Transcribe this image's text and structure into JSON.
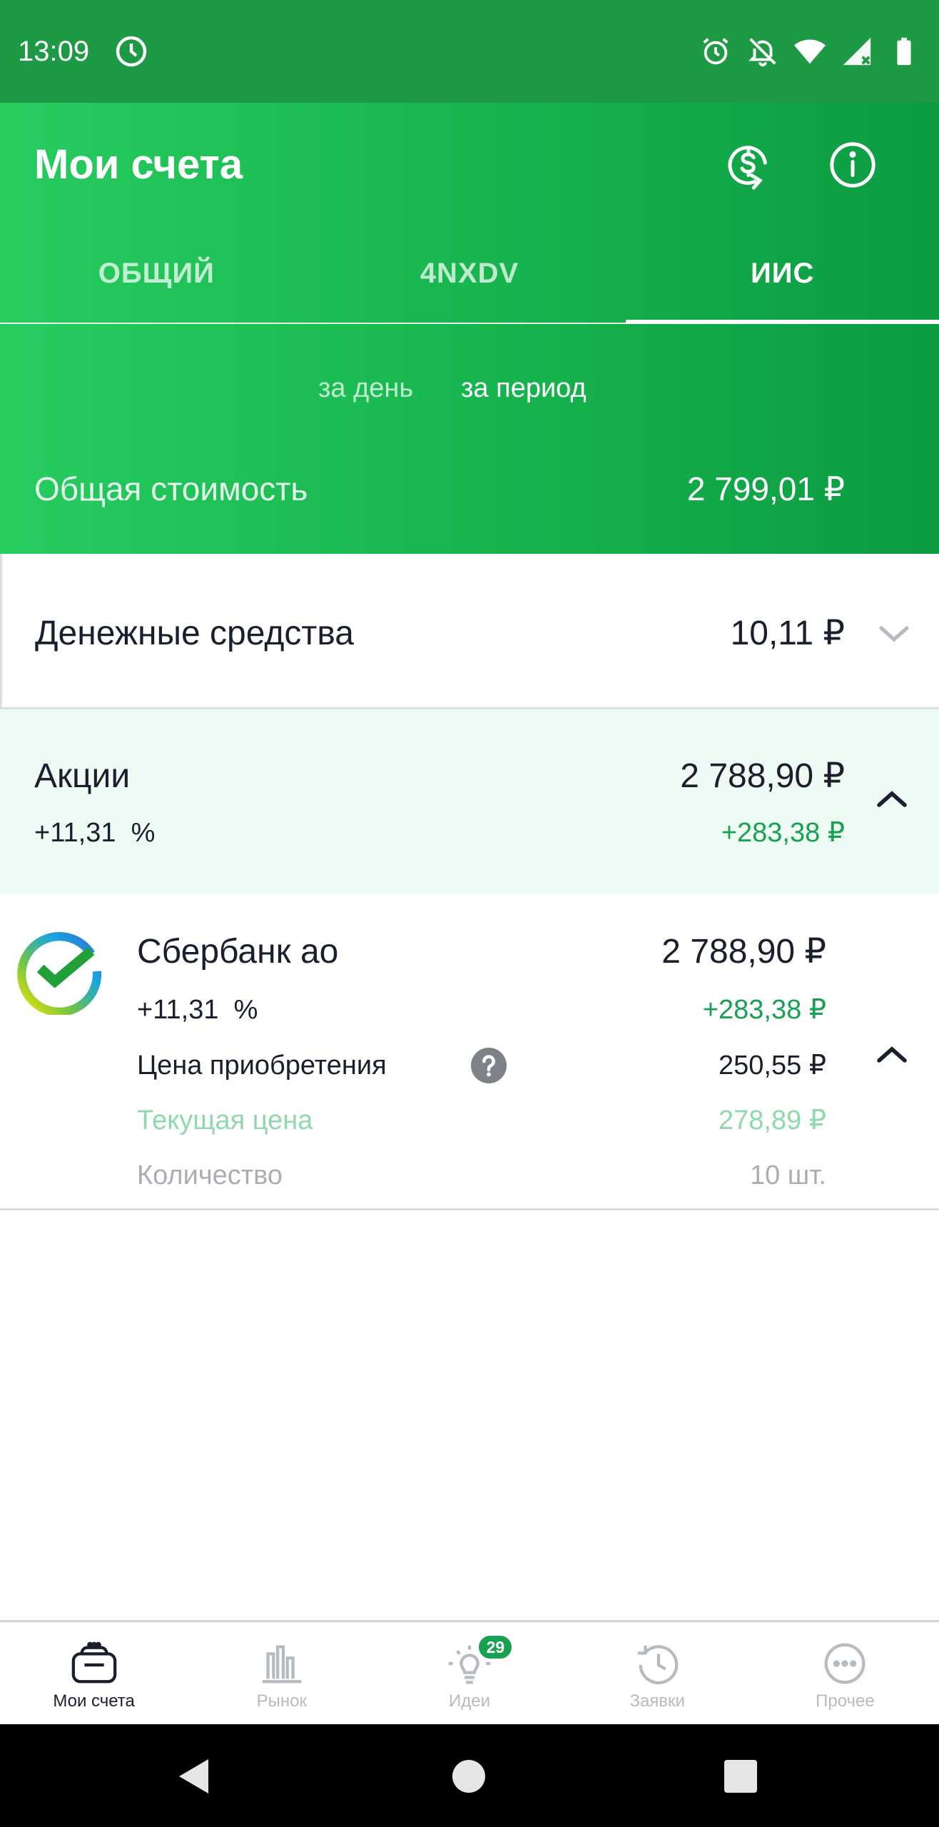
{
  "status_bar": {
    "time": "13:09",
    "icons": [
      "clock-icon",
      "alarm-icon",
      "notifications-off-icon",
      "wifi-icon",
      "signal-icon",
      "battery-icon"
    ]
  },
  "header": {
    "title": "Мои счета",
    "currency_button_icon": "currency-exchange-icon",
    "info_button_icon": "info-icon",
    "background_color": "#1ab552"
  },
  "tabs": [
    {
      "label": "ОБЩИЙ",
      "active": false
    },
    {
      "label": "4NXDV",
      "active": false
    },
    {
      "label": "ИИС",
      "active": true
    }
  ],
  "period": {
    "day_label": "за день",
    "range_label": "за период",
    "selected": "range"
  },
  "total": {
    "label": "Общая стоимость",
    "value": "2 799,01 ₽"
  },
  "cash": {
    "label": "Денежные средства",
    "value": "10,11 ₽"
  },
  "stocks": {
    "label": "Акции",
    "value": "2 788,90 ₽",
    "percent": "+11,31  %",
    "gain": "+283,38 ₽"
  },
  "security": {
    "name": "Сбербанк ао",
    "value": "2 788,90 ₽",
    "percent": "+11,31  %",
    "gain": "+283,38 ₽",
    "details": [
      {
        "label": "Цена приобретения",
        "value": "250,55 ₽"
      },
      {
        "label": "Текущая цена",
        "value": "278,89 ₽"
      },
      {
        "label": "Количество",
        "value": "10 шт."
      }
    ]
  },
  "bottom_nav": [
    {
      "label": "Мои счета",
      "icon": "wallet-icon",
      "active": true
    },
    {
      "label": "Рынок",
      "icon": "market-chart-icon",
      "active": false
    },
    {
      "label": "Идеи",
      "icon": "lightbulb-icon",
      "active": false,
      "badge": "29"
    },
    {
      "label": "Заявки",
      "icon": "history-clock-icon",
      "active": false
    },
    {
      "label": "Прочее",
      "icon": "more-icon",
      "active": false
    }
  ],
  "colors": {
    "accent_green": "#1aa052",
    "gain_green": "#1aa052",
    "light_green_bg": "#eefaf4"
  }
}
